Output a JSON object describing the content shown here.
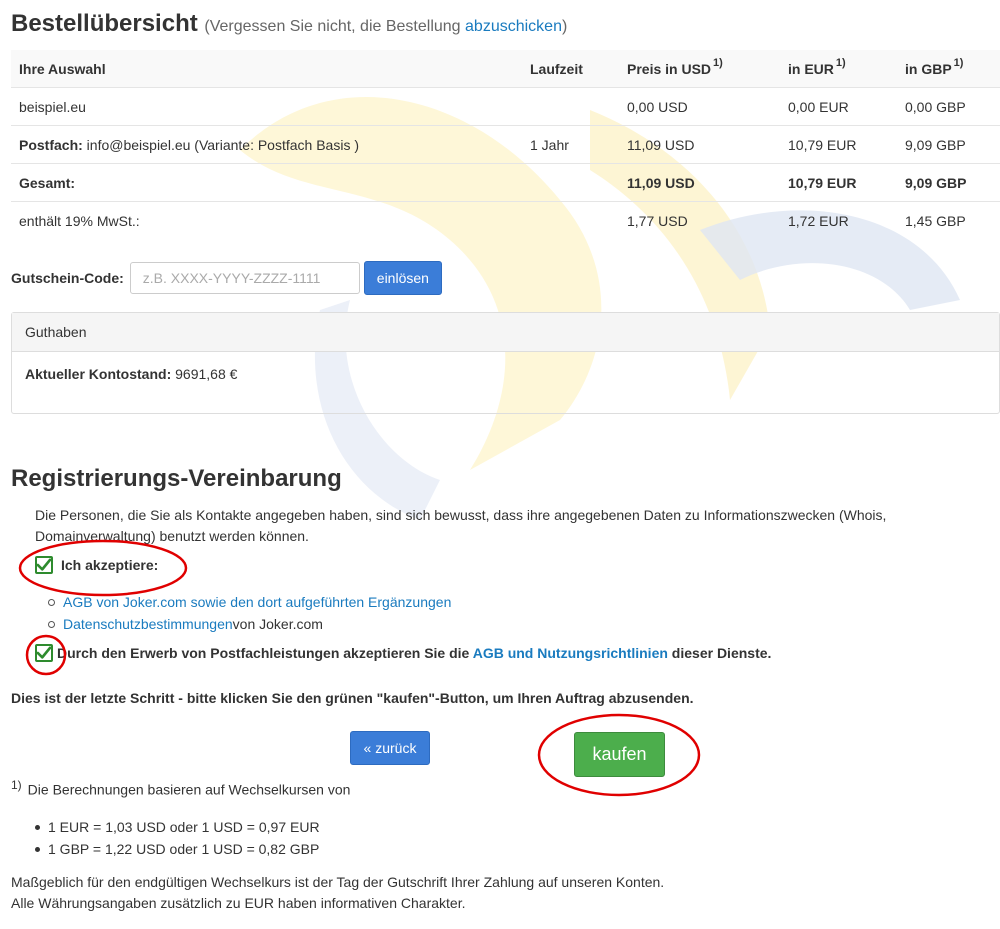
{
  "header": {
    "title": "Bestellübersicht",
    "note_prefix": "(Vergessen Sie nicht, die Bestellung ",
    "note_link": "abzuschicken",
    "note_suffix": ")"
  },
  "table": {
    "columns": [
      "Ihre Auswahl",
      "Laufzeit",
      "Preis in USD",
      "in EUR",
      "in GBP"
    ],
    "footnote_mark": "1)",
    "rows": [
      {
        "label": "beispiel.eu",
        "bold_label": "",
        "duration": "",
        "usd": "0,00 USD",
        "eur": "0,00 EUR",
        "gbp": "0,00 GBP"
      },
      {
        "bold_label": "Postfach:",
        "label": " info@beispiel.eu (Variante: Postfach Basis )",
        "duration": "1 Jahr",
        "usd": "11,09 USD",
        "eur": "10,79 EUR",
        "gbp": "9,09 GBP"
      },
      {
        "bold_label": "Gesamt:",
        "label": "",
        "duration": "",
        "usd": "11,09 USD",
        "eur": "10,79 EUR",
        "gbp": "9,09 GBP"
      },
      {
        "label": "enthält 19% MwSt.:",
        "bold_label": "",
        "duration": "",
        "usd": "1,77 USD",
        "eur": "1,72 EUR",
        "gbp": "1,45 GBP"
      }
    ]
  },
  "voucher": {
    "label": "Gutschein-Code:",
    "placeholder": "z.B. XXXX-YYYY-ZZZZ-1111",
    "button": "einlösen"
  },
  "credit": {
    "heading": "Guthaben",
    "balance_label": "Aktueller Kontostand:",
    "balance_value": "9691,68 €"
  },
  "agreement": {
    "title": "Registrierungs-Vereinbarung",
    "intro": "Die Personen, die Sie als Kontakte angegeben haben, sind sich bewusst, dass ihre angegebenen Daten zu Informationszwecken (Whois, Domainverwaltung) benutzt werden können.",
    "accept_label": "Ich akzeptiere:",
    "links": [
      {
        "link": "AGB von Joker.com sowie den dort aufgeführten Ergänzungen",
        "suffix": ""
      },
      {
        "link": "Datenschutzbestimmungen",
        "suffix": " von Joker.com"
      }
    ],
    "mailbox_prefix": "Durch den Erwerb von Postfachleistungen akzeptieren Sie die ",
    "mailbox_link": "AGB und Nutzungsrichtlinien",
    "mailbox_suffix": " dieser Dienste.",
    "accept_checked": true,
    "mailbox_checked": true
  },
  "last_step": "Dies ist der letzte Schritt - bitte klicken Sie den grünen \"kaufen\"-Button, um Ihren Auftrag abzusenden.",
  "buttons": {
    "back": "« zurück",
    "buy": "kaufen"
  },
  "footnote": {
    "mark": "1)",
    "text": "Die Berechnungen basieren auf Wechselkursen von",
    "rates": [
      "1 EUR = 1,03 USD oder 1 USD = 0,97 EUR",
      "1 GBP = 1,22 USD oder 1 USD = 0,82 GBP"
    ],
    "line1": "Maßgeblich für den endgültigen Wechselkurs ist der Tag der Gutschrift Ihrer Zahlung auf unseren Konten.",
    "line2": "Alle Währungsangaben zusätzlich zu EUR haben informativen Charakter."
  },
  "colors": {
    "accent_blue": "#3b7dd8",
    "buy_green": "#4cae4c",
    "link": "#1a7bbf",
    "annotation_red": "#e00000"
  }
}
